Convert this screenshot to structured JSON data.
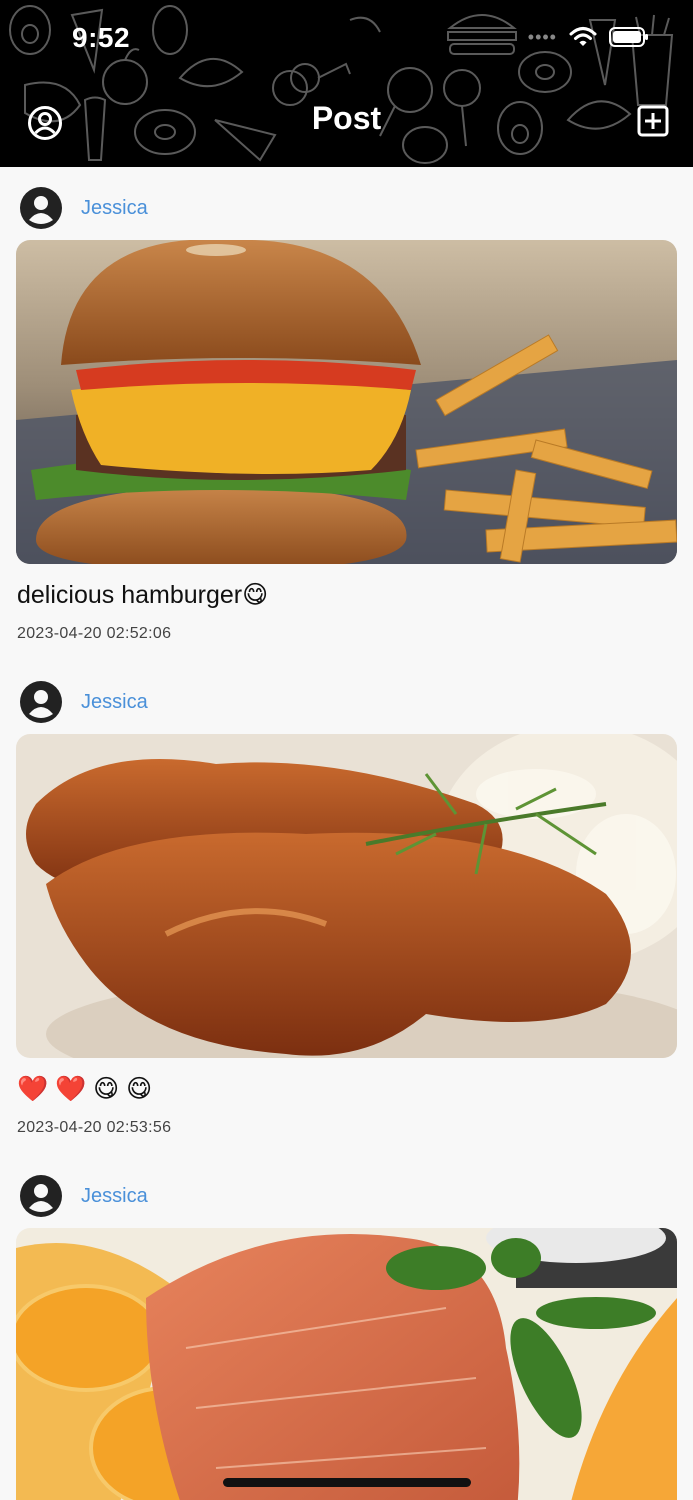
{
  "status_bar": {
    "time": "9:52"
  },
  "header": {
    "title": "Post"
  },
  "posts": [
    {
      "username": "Jessica",
      "caption": "delicious hamburger😋",
      "date": "2023-04-20 02:52:06"
    },
    {
      "username": "Jessica",
      "caption": "❤️ ❤️ 😋 😋",
      "date": "2023-04-20 02:53:56"
    },
    {
      "username": "Jessica"
    }
  ],
  "icons": {
    "profile": "profile-circle-icon",
    "add": "add-square-icon",
    "avatar": "avatar-icon",
    "wifi": "wifi-icon",
    "battery": "battery-icon"
  },
  "colors": {
    "header_bg": "#000000",
    "username": "#4a90d9",
    "page_bg": "#f8f8f8"
  }
}
